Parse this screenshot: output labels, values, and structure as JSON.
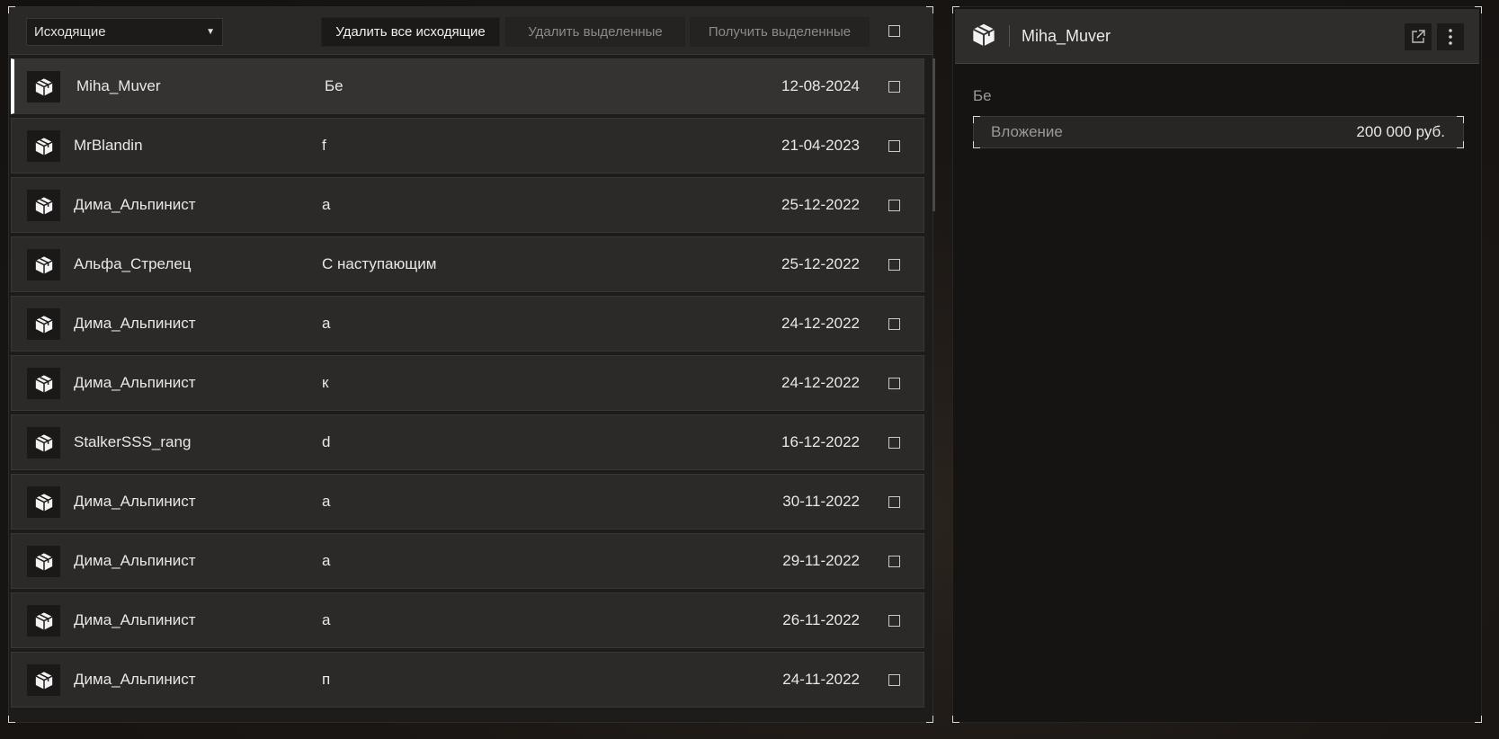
{
  "toolbar": {
    "folder_select_value": "Исходящие",
    "delete_all_label": "Удалить все исходящие",
    "delete_selected_label": "Удалить выделенные",
    "get_selected_label": "Получить выделенные"
  },
  "messages": [
    {
      "sender": "Miha_Muver",
      "subject": "Бе",
      "date": "12-08-2024",
      "selected": true
    },
    {
      "sender": "MrBlandin",
      "subject": "f",
      "date": "21-04-2023"
    },
    {
      "sender": "Дима_Альпинист",
      "subject": "а",
      "date": "25-12-2022"
    },
    {
      "sender": "Альфа_Стрелец",
      "subject": "С наступающим",
      "date": "25-12-2022"
    },
    {
      "sender": "Дима_Альпинист",
      "subject": "а",
      "date": "24-12-2022"
    },
    {
      "sender": "Дима_Альпинист",
      "subject": "к",
      "date": "24-12-2022"
    },
    {
      "sender": "StalkerSSS_rang",
      "subject": "d",
      "date": "16-12-2022"
    },
    {
      "sender": "Дима_Альпинист",
      "subject": "а",
      "date": "30-11-2022"
    },
    {
      "sender": "Дима_Альпинист",
      "subject": "а",
      "date": "29-11-2022"
    },
    {
      "sender": "Дима_Альпинист",
      "subject": "а",
      "date": "26-11-2022"
    },
    {
      "sender": "Дима_Альпинист",
      "subject": "п",
      "date": "24-11-2022"
    }
  ],
  "detail": {
    "title": "Miha_Muver",
    "subject": "Бе",
    "attachment_label": "Вложение",
    "attachment_value": "200 000 руб."
  },
  "icons": {
    "row_icon": "package-box-icon",
    "header_icon": "package-box-icon",
    "open_external": "external-link-icon",
    "more_menu": "vertical-dots-icon"
  }
}
